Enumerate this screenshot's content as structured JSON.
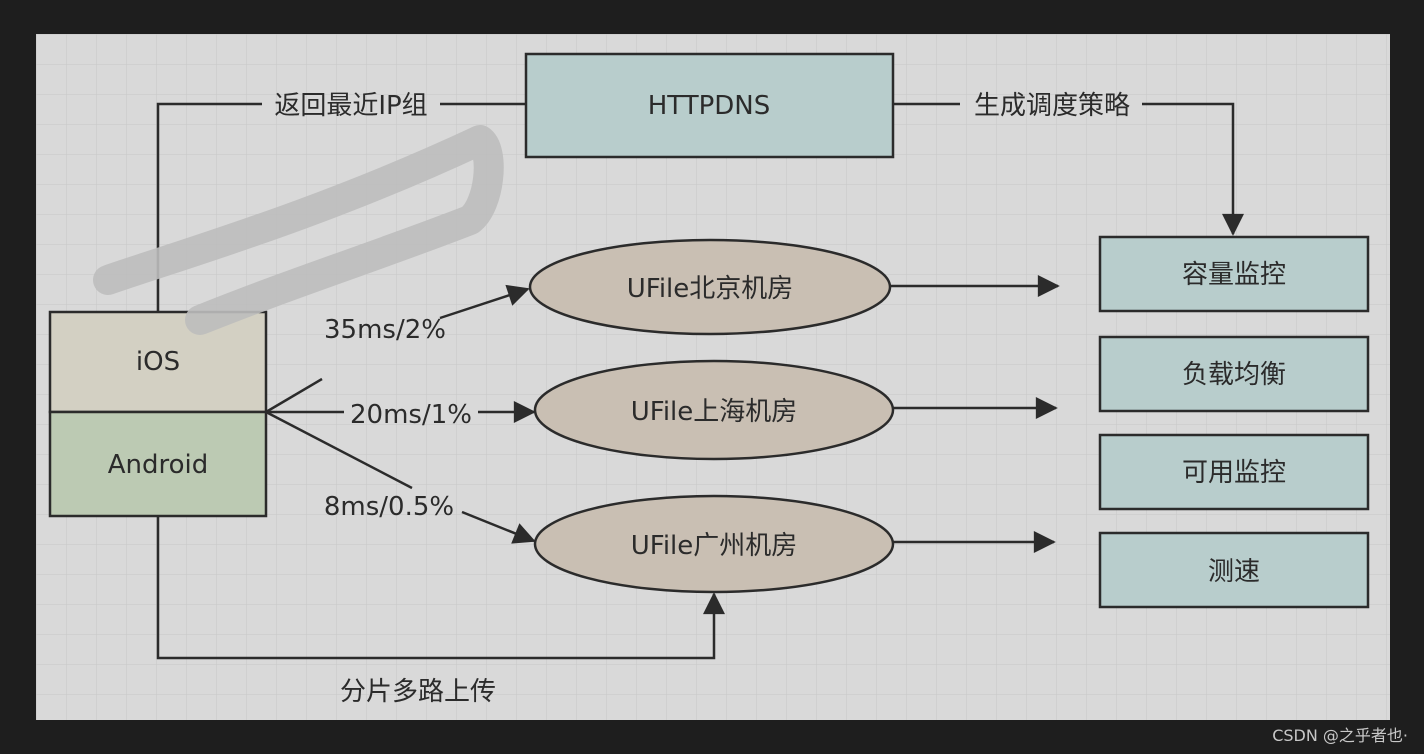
{
  "diagram": {
    "colors": {
      "canvas": "#d9d9d9",
      "grid": "#c7c7c7",
      "stroke": "#2b2b2b",
      "httpdns_fill": "#b8cdcc",
      "ios_fill": "#d3d0c3",
      "android_fill": "#bccab3",
      "datacenter_fill": "#c9bfb3",
      "service_fill": "#b8cdcc",
      "scribble": "#bdbdbd"
    },
    "nodes": {
      "httpdns": "HTTPDNS",
      "ios": "iOS",
      "android": "Android",
      "dc_beijing": "UFile北京机房",
      "dc_shanghai": "UFile上海机房",
      "dc_guangzhou": "UFile广州机房",
      "svc_capacity": "容量监控",
      "svc_load_balance": "负载均衡",
      "svc_availability": "可用监控",
      "svc_speed_test": "测速"
    },
    "edges": {
      "return_ip_group": "返回最近IP组",
      "generate_policy": "生成调度策略",
      "to_beijing": "35ms/2%",
      "to_shanghai": "20ms/1%",
      "to_guangzhou": "8ms/0.5%",
      "multipart_upload": "分片多路上传"
    }
  },
  "watermark": "CSDN @之乎者也·"
}
